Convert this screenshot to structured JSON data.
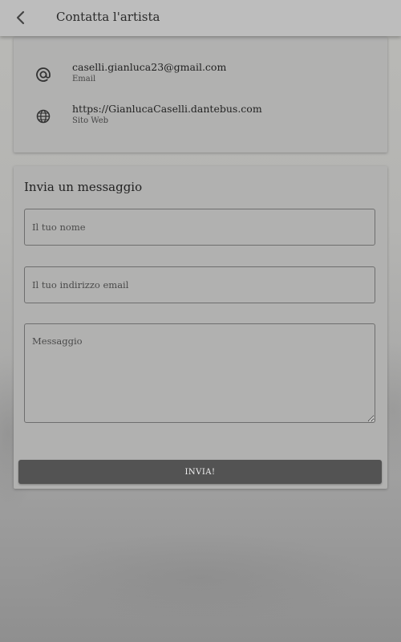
{
  "appbar": {
    "title": "Contatta l'artista",
    "back_icon": "chevron-left-icon"
  },
  "contact_info": {
    "items": [
      {
        "icon": "at-icon",
        "value": "caselli.gianluca23@gmail.com",
        "label": "Email"
      },
      {
        "icon": "globe-icon",
        "value": "https://GianlucaCaselli.dantebus.com",
        "label": "Sito Web"
      }
    ]
  },
  "form": {
    "title": "Invia un messaggio",
    "name_placeholder": "Il tuo nome",
    "name_value": "",
    "email_placeholder": "Il tuo indirizzo email",
    "email_value": "",
    "message_placeholder": "Messaggio",
    "message_value": "",
    "submit_label": "INVIA!"
  },
  "colors": {
    "appbar": "#bdbdbd",
    "card": "#b1b1b0",
    "button": "#535353",
    "button_text": "#f2f2f2"
  }
}
